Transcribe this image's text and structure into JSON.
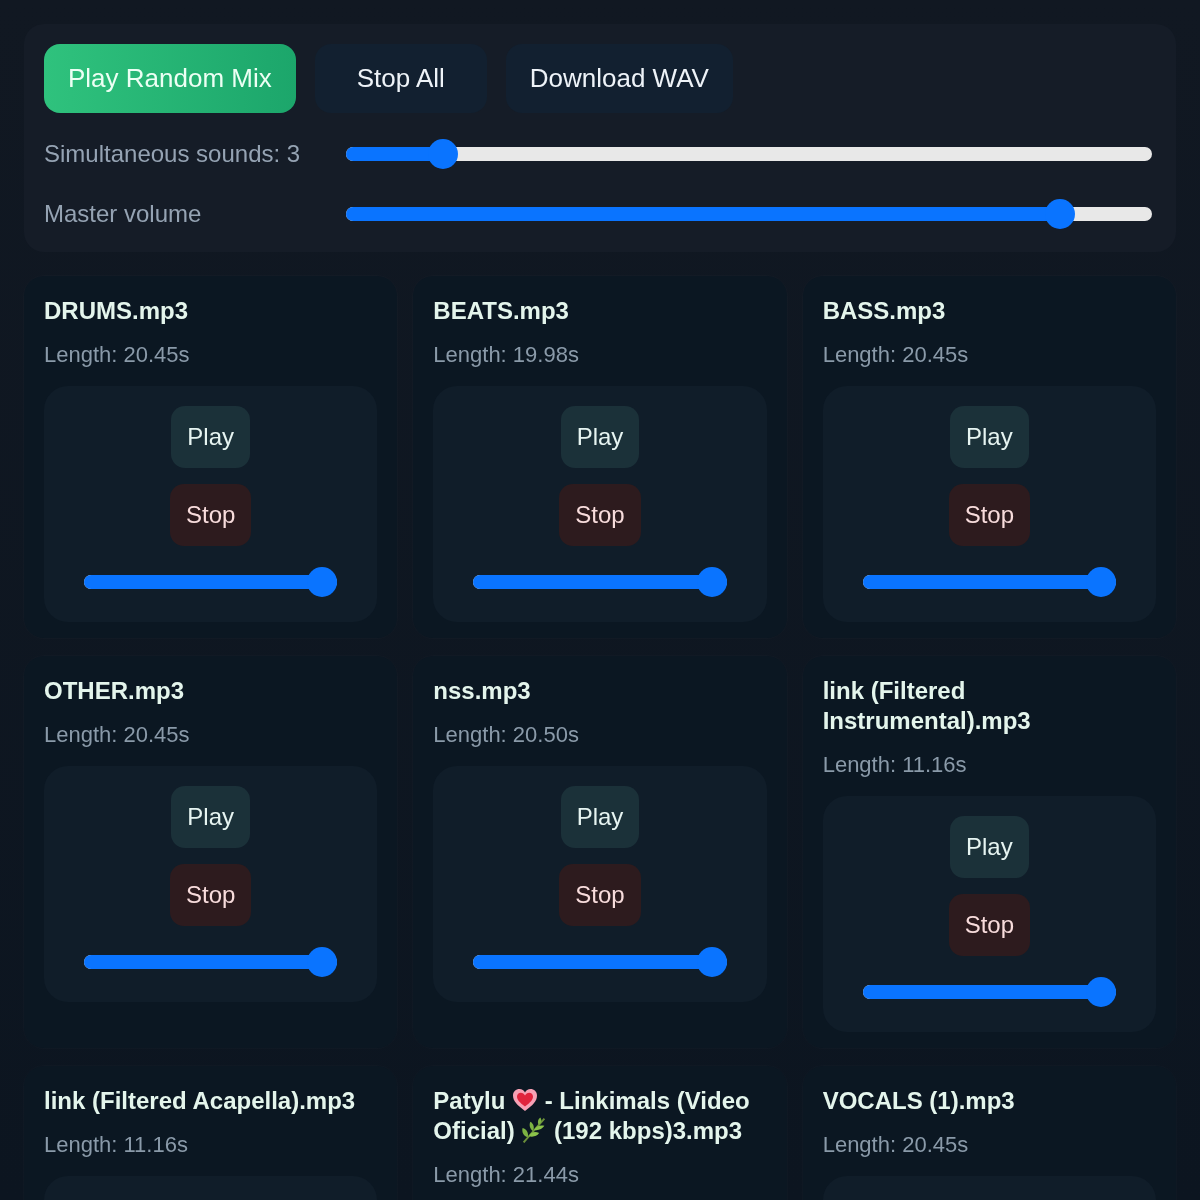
{
  "toolbar": {
    "buttons": [
      {
        "label": "Play Random Mix",
        "kind": "primary"
      },
      {
        "label": "Stop All",
        "kind": "secondary"
      },
      {
        "label": "Download WAV",
        "kind": "secondary"
      }
    ]
  },
  "settings": [
    {
      "label": "Simultaneous sounds: 3",
      "level": 0.12
    },
    {
      "label": "Master volume",
      "level": 0.886
    }
  ],
  "tracks": [
    {
      "title": "DRUMS.mp3",
      "length": "Length: 20.45s",
      "play": "Play",
      "stop": "Stop",
      "volume": {
        "level": 1
      }
    },
    {
      "title": "BEATS.mp3",
      "length": "Length: 19.98s",
      "play": "Play",
      "stop": "Stop",
      "volume": {
        "level": 1
      }
    },
    {
      "title": "BASS.mp3",
      "length": "Length: 20.45s",
      "play": "Play",
      "stop": "Stop",
      "volume": {
        "level": 1
      }
    },
    {
      "title": "OTHER.mp3",
      "length": "Length: 20.45s",
      "play": "Play",
      "stop": "Stop",
      "volume": {
        "level": 1
      }
    },
    {
      "title": "nss.mp3",
      "length": "Length: 20.50s",
      "play": "Play",
      "stop": "Stop",
      "volume": {
        "level": 1
      }
    },
    {
      "title": "link (Filtered Instrumental).mp3",
      "length": "Length: 11.16s",
      "play": "Play",
      "stop": "Stop",
      "volume": {
        "level": 1
      }
    },
    {
      "title": "link (Filtered Acapella).mp3",
      "length": "Length: 11.16s"
    },
    {
      "title_parts": [
        {
          "kind": "text",
          "text": "Patylu"
        },
        {
          "kind": "heart"
        },
        {
          "kind": "text",
          "text": "- Linkimals (Video"
        },
        {
          "kind": "text",
          "text": "Oficial)"
        },
        {
          "kind": "herb"
        },
        {
          "kind": "text",
          "text": "(192 kbps)3.mp3"
        }
      ],
      "length": "Length: 21.44s"
    },
    {
      "title": "VOCALS (1).mp3",
      "length": "Length: 20.45s"
    }
  ]
}
